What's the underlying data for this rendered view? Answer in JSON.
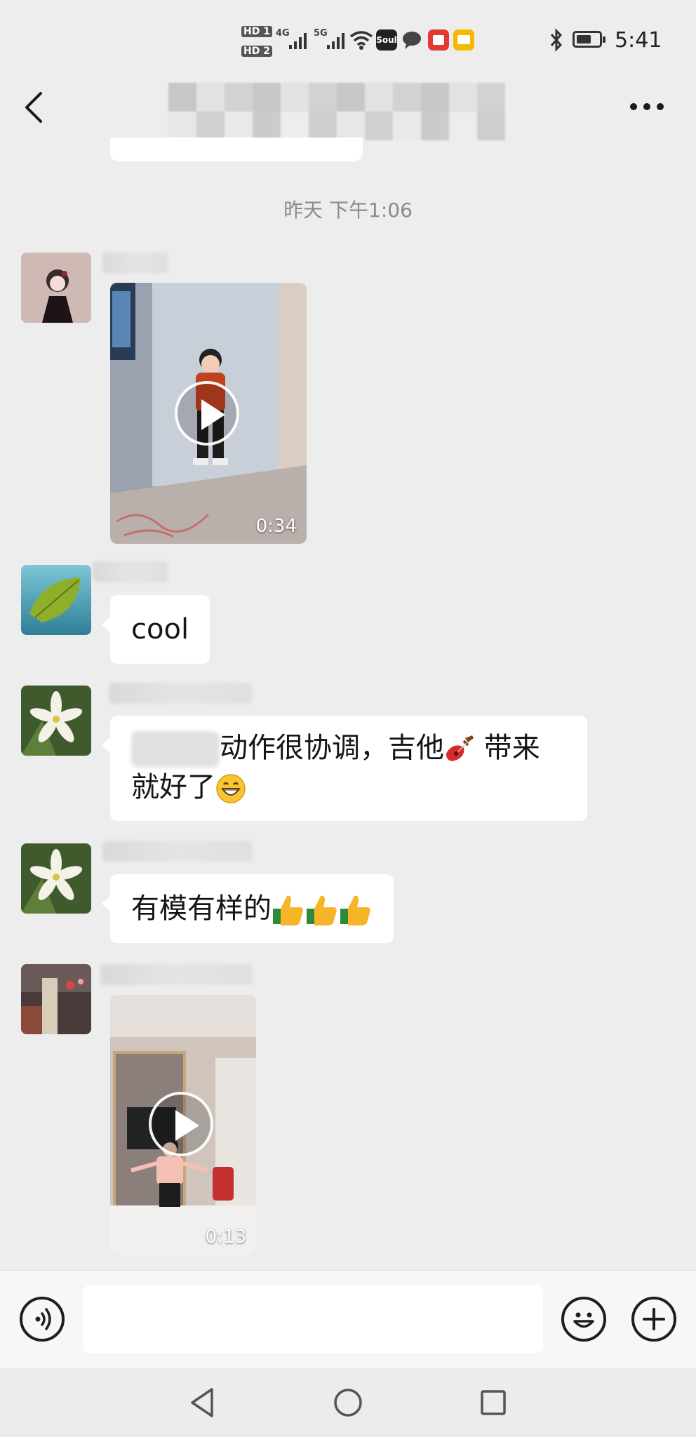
{
  "status_bar": {
    "hd1": "HD 1",
    "hd2": "HD 2",
    "net1": "4G",
    "net2": "5G",
    "soul_app": "Soul",
    "time": "5:41",
    "icons": [
      "signal-icon",
      "wifi-icon",
      "soul-app-icon",
      "message-app-icon",
      "red-app-icon",
      "mail-app-icon",
      "bluetooth-icon",
      "battery-icon"
    ]
  },
  "header": {
    "back_icon": "back-arrow-icon",
    "more_icon": "more-dots-icon"
  },
  "chat": {
    "time_separator": "昨天 下午1:06",
    "messages": [
      {
        "type": "video",
        "duration": "0:34"
      },
      {
        "type": "text",
        "text": "cool"
      },
      {
        "type": "text",
        "text_part1": "动作很协调，吉他",
        "text_part2": " 带来",
        "text_part3": "就好了"
      },
      {
        "type": "text",
        "text": "有模有样的"
      },
      {
        "type": "video",
        "duration": "0:13"
      }
    ]
  },
  "input_bar": {
    "voice_icon": "voice-input-icon",
    "emoji_icon": "emoji-icon",
    "plus_icon": "plus-icon",
    "value": ""
  },
  "nav_bar": {
    "icons": [
      "nav-back-icon",
      "nav-home-icon",
      "nav-recents-icon"
    ]
  },
  "colors": {
    "background": "#ededed",
    "bubble": "#ffffff",
    "text": "#151515",
    "timestamp": "#8a8a8a"
  }
}
